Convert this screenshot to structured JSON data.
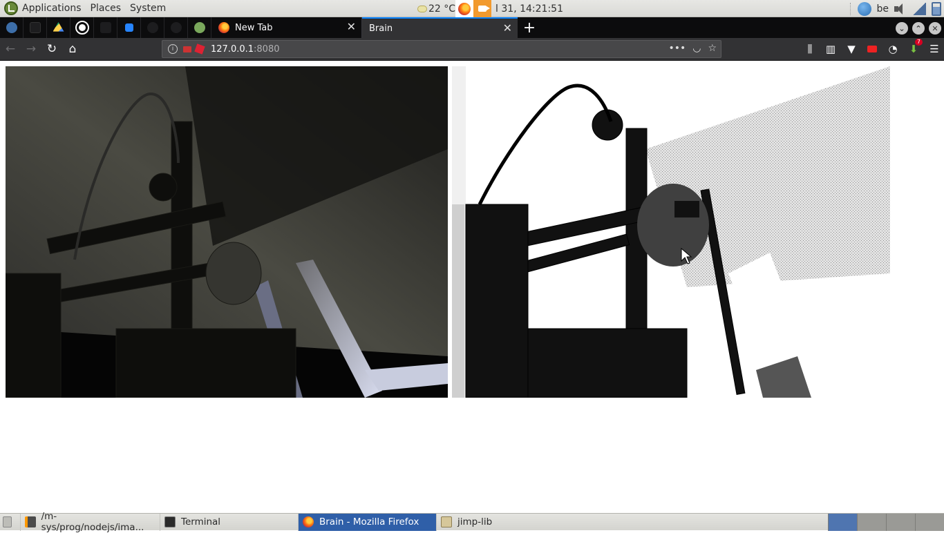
{
  "top_panel": {
    "menus": [
      "Applications",
      "Places",
      "System"
    ],
    "weather_temp": "22 °C",
    "clock": "l 31, 14:21:51",
    "keyboard_layout": "be"
  },
  "tabs": [
    {
      "label": "New Tab",
      "active": false
    },
    {
      "label": "Brain",
      "active": true
    }
  ],
  "url": {
    "host": "127.0.0.1",
    "port": ":8080"
  },
  "toolbar": {
    "downloads_badge": "7"
  },
  "taskbar": {
    "items": [
      {
        "label": "/m-sys/prog/nodejs/ima...",
        "icon": "sublime-icon"
      },
      {
        "label": "Terminal",
        "icon": "terminal-icon"
      },
      {
        "label": "Brain - Mozilla Firefox",
        "icon": "firefox-icon",
        "active": true
      },
      {
        "label": "jimp-lib",
        "icon": "folder-icon"
      }
    ]
  },
  "colors": {
    "accent": "#0a84ff",
    "taskbar_active": "#2f5fa8",
    "tabbar_bg": "#0c0c0d",
    "navbar_bg": "#323234"
  }
}
